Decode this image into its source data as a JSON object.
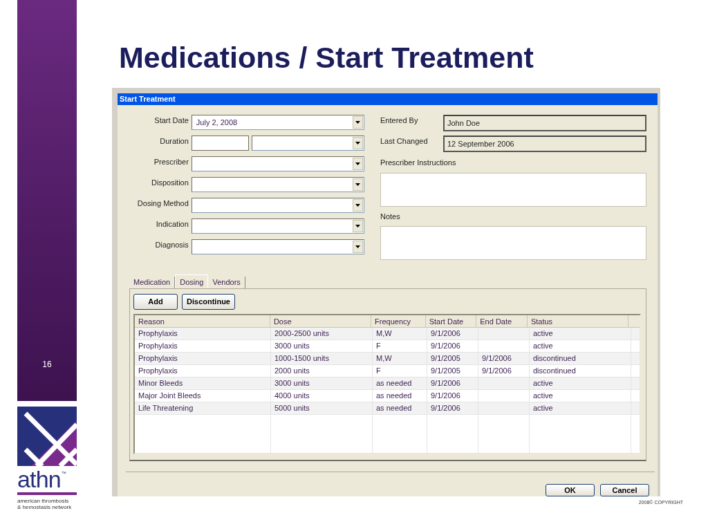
{
  "slide": {
    "title": "Medications / Start Treatment",
    "page_number": "16",
    "logo": {
      "wordmark": "athn",
      "trademark": "™",
      "tagline": [
        "american thrombosis",
        "& hemostasis network"
      ]
    },
    "copyright": "2008© COPYRIGHT"
  },
  "dialog": {
    "title": "Start Treatment",
    "left_fields": [
      {
        "label": "Start Date",
        "kind": "combo",
        "value": "July 2, 2008"
      },
      {
        "label": "Duration",
        "kind": "text_combo"
      },
      {
        "label": "Prescriber",
        "kind": "combo"
      },
      {
        "label": "Disposition",
        "kind": "combo"
      },
      {
        "label": "Dosing Method",
        "kind": "combo"
      },
      {
        "label": "Indication",
        "kind": "combo"
      },
      {
        "label": "Diagnosis",
        "kind": "combo"
      }
    ],
    "right_fields": [
      {
        "label": "Entered By",
        "kind": "readonly",
        "value": "John Doe"
      },
      {
        "label": "Last Changed",
        "kind": "readonly",
        "value": "12 September 2006"
      },
      {
        "label": "Prescriber Instructions",
        "kind": "textarea"
      },
      {
        "label": "Notes",
        "kind": "textarea"
      }
    ],
    "tabs": [
      {
        "label": "Medication",
        "selected": false
      },
      {
        "label": "Dosing",
        "selected": true
      },
      {
        "label": "Vendors",
        "selected": false
      }
    ],
    "actions": [
      "Add",
      "Discontinue"
    ],
    "table": {
      "columns": [
        "Reason",
        "Dose",
        "Frequency",
        "Start Date",
        "End Date",
        "Status"
      ],
      "rows": [
        {
          "reason": "Prophylaxis",
          "dose": "2000-2500 units",
          "frequency": "M,W",
          "start_date": "9/1/2006",
          "status": "active"
        },
        {
          "reason": "Prophylaxis",
          "dose": "3000 units",
          "frequency": "F",
          "start_date": "9/1/2006",
          "status": "active"
        },
        {
          "reason": "Prophylaxis",
          "dose": "1000-1500 units",
          "frequency": "M,W",
          "start_date": "9/1/2005",
          "end_date": "9/1/2006",
          "status": "discontinued"
        },
        {
          "reason": "Prophylaxis",
          "dose": "2000 units",
          "frequency": "F",
          "start_date": "9/1/2005",
          "end_date": "9/1/2006",
          "status": "discontinued"
        },
        {
          "reason": "Minor Bleeds",
          "dose": "3000 units",
          "frequency": "as needed",
          "start_date": "9/1/2006",
          "status": "active"
        },
        {
          "reason": "Major Joint Bleeds",
          "dose": "4000 units",
          "frequency": "as needed",
          "start_date": "9/1/2006",
          "status": "active"
        },
        {
          "reason": "Life Threatening",
          "dose": "5000 units",
          "frequency": "as needed",
          "start_date": "9/1/2006",
          "status": "active"
        }
      ]
    },
    "buttons": [
      "OK",
      "Cancel"
    ]
  }
}
